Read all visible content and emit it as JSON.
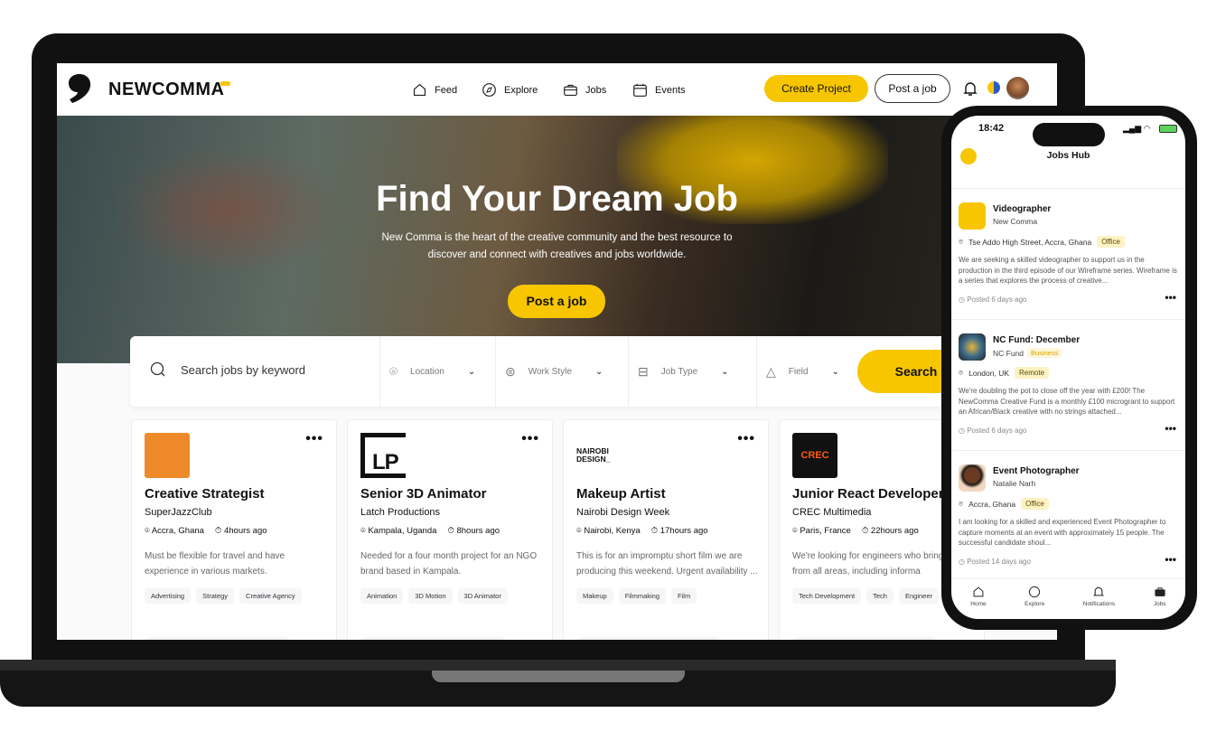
{
  "brand": {
    "name": "NEWCOMMA",
    "accent": "#f7c600"
  },
  "nav": {
    "items": [
      {
        "label": "Feed",
        "icon": "home-icon"
      },
      {
        "label": "Explore",
        "icon": "compass-icon"
      },
      {
        "label": "Jobs",
        "icon": "briefcase-icon"
      },
      {
        "label": "Events",
        "icon": "calendar-icon"
      }
    ],
    "create_project": "Create Project",
    "post_job": "Post a job"
  },
  "hero": {
    "title": "Find Your Dream Job",
    "subtitle": "New Comma is the heart of the creative community and the best resource to discover and connect with creatives and jobs worldwide.",
    "cta": "Post a job"
  },
  "search": {
    "placeholder": "Search jobs by keyword",
    "filters": [
      "Location",
      "Work Style",
      "Job Type",
      "Field"
    ],
    "button": "Search"
  },
  "cards": [
    {
      "title": "Creative Strategist",
      "company": "SuperJazzClub",
      "location": "Accra, Ghana",
      "time": "4hours ago",
      "desc": "Must be flexible for travel and have experience in various markets.",
      "tags": [
        "Advertising",
        "Strategy",
        "Creative Agency"
      ]
    },
    {
      "title": "Senior 3D Animator",
      "company": "Latch Productions",
      "location": "Kampala, Uganda",
      "time": "8hours ago",
      "desc": "Needed for a four month project for an NGO brand based in Kampala.",
      "tags": [
        "Animation",
        "3D Motion",
        "3D Animator"
      ],
      "logo_text": "LP"
    },
    {
      "title": "Makeup Artist",
      "company": "Nairobi Design Week",
      "location": "Nairobi, Kenya",
      "time": "17hours ago",
      "desc": "This is for an impromptu short film we are producing this weekend. Urgent availability ...",
      "tags": [
        "Makeup",
        "Filmmaking",
        "Film"
      ],
      "logo_text": "NAIROBI DESIGN_"
    },
    {
      "title": "Junior React Developer",
      "company": "CREC Multimedia",
      "location": "Paris, France",
      "time": "22hours ago",
      "desc": "We're looking for engineers who bring ideas from all areas, including informa",
      "tags": [
        "Tech Development",
        "Tech",
        "Engineer"
      ],
      "logo_text": "CREC"
    }
  ],
  "phone": {
    "time": "18:42",
    "title": "Jobs Hub",
    "jobs": [
      {
        "title": "Videographer",
        "company": "New Comma",
        "location": "Tse Addo High Street, Accra, Ghana",
        "badge": "Office",
        "desc": "We are seeking a skilled videographer to support us in the production in the third episode of our Wireframe series. Wireframe is a series that explores the process of creative...",
        "posted": "Posted 6 days ago"
      },
      {
        "title": "NC Fund: December",
        "company": "NC Fund",
        "company_badge": "Business",
        "location": "London, UK",
        "badge": "Remote",
        "desc": "We're doubling the pot to close off the year with £200! The NewComma Creative Fund is a monthly £100 microgrant to support an African/Black creative with no strings attached...",
        "posted": "Posted 6 days ago"
      },
      {
        "title": "Event Photographer",
        "company": "Natalie Narh",
        "location": "Accra, Ghana",
        "badge": "Office",
        "desc": "I am looking for a skilled and experienced Event Photographer to capture moments at an event with approximately 15 people. The successful candidate shoul...",
        "posted": "Posted 14 days ago"
      }
    ],
    "tabs": [
      "Home",
      "Explore",
      "Notifications",
      "Jobs"
    ]
  }
}
